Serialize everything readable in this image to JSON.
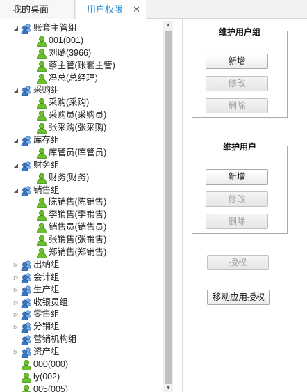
{
  "tabs": [
    {
      "label": "我的桌面",
      "active": false
    },
    {
      "label": "用户权限",
      "active": true,
      "close": "✕"
    }
  ],
  "tree": [
    {
      "label": "账套主管组",
      "type": "group",
      "expanded": true,
      "level": 0
    },
    {
      "label": "001(001)",
      "type": "user",
      "level": 1
    },
    {
      "label": "刘璐(3966)",
      "type": "user",
      "level": 1
    },
    {
      "label": "蔡主管(账套主管)",
      "type": "user",
      "level": 1
    },
    {
      "label": "冯总(总经理)",
      "type": "user",
      "level": 1
    },
    {
      "label": "采购组",
      "type": "group",
      "expanded": true,
      "level": 0
    },
    {
      "label": "采购(采购)",
      "type": "user",
      "level": 1
    },
    {
      "label": "采购员(采购员)",
      "type": "user",
      "level": 1
    },
    {
      "label": "张采购(张采购)",
      "type": "user",
      "level": 1
    },
    {
      "label": "库存组",
      "type": "group",
      "expanded": true,
      "level": 0
    },
    {
      "label": "库管员(库管员)",
      "type": "user",
      "level": 1
    },
    {
      "label": "财务组",
      "type": "group",
      "expanded": true,
      "level": 0
    },
    {
      "label": "财务(财务)",
      "type": "user",
      "level": 1
    },
    {
      "label": "销售组",
      "type": "group",
      "expanded": true,
      "level": 0
    },
    {
      "label": "陈销售(陈销售)",
      "type": "user",
      "level": 1
    },
    {
      "label": "李销售(李销售)",
      "type": "user",
      "level": 1
    },
    {
      "label": "销售员(销售员)",
      "type": "user",
      "level": 1
    },
    {
      "label": "张销售(张销售)",
      "type": "user",
      "level": 1
    },
    {
      "label": "郑销售(郑销售)",
      "type": "user",
      "level": 1
    },
    {
      "label": "出纳组",
      "type": "group",
      "expanded": false,
      "level": 0
    },
    {
      "label": "会计组",
      "type": "group",
      "expanded": false,
      "level": 0
    },
    {
      "label": "生产组",
      "type": "group",
      "expanded": false,
      "level": 0
    },
    {
      "label": "收银员组",
      "type": "group",
      "expanded": false,
      "level": 0
    },
    {
      "label": "零售组",
      "type": "group",
      "expanded": false,
      "level": 0
    },
    {
      "label": "分销组",
      "type": "group",
      "expanded": false,
      "level": 0
    },
    {
      "label": "营销机构组",
      "type": "group",
      "expanded": null,
      "level": 0
    },
    {
      "label": "资产组",
      "type": "group",
      "expanded": false,
      "level": 0
    },
    {
      "label": "000(000)",
      "type": "user",
      "level": 0
    },
    {
      "label": "ly(002)",
      "type": "user",
      "level": 0
    },
    {
      "label": "005(005)",
      "type": "user",
      "level": 0
    }
  ],
  "user_group_panel": {
    "title": "维护用户组",
    "add": "新增",
    "edit": "修改",
    "delete": "删除"
  },
  "user_panel": {
    "title": "维护用户",
    "add": "新增",
    "edit": "修改",
    "delete": "删除"
  },
  "authorize_button": "授权",
  "mobile_authorize_button": "移动应用授权",
  "colors": {
    "active_tab_text": "#2a8fd8",
    "user_icon": "#6cbf2d",
    "group_icon": "#3a78c8"
  }
}
